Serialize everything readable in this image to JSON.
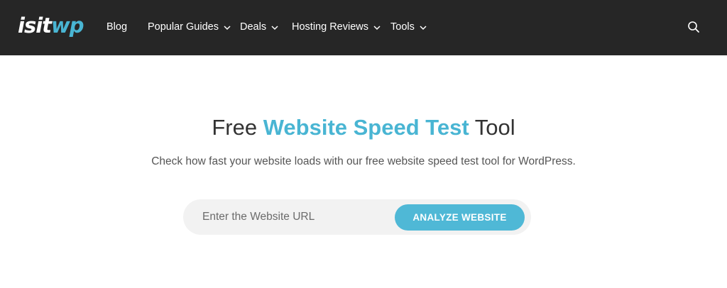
{
  "header": {
    "logo": {
      "part1": "isit",
      "part2": "wp"
    },
    "nav": [
      {
        "label": "Blog",
        "has_dropdown": false
      },
      {
        "label": "Popular Guides",
        "has_dropdown": true
      },
      {
        "label": "Deals",
        "has_dropdown": true
      },
      {
        "label": "Hosting Reviews",
        "has_dropdown": true
      },
      {
        "label": "Tools",
        "has_dropdown": true
      }
    ],
    "search_icon": "search-icon"
  },
  "hero": {
    "title_before": "Free ",
    "title_highlight": "Website Speed Test",
    "title_after": " Tool",
    "subtitle": "Check how fast your website loads with our free website speed test tool for WordPress."
  },
  "form": {
    "url_value": "",
    "url_placeholder": "Enter the Website URL",
    "submit_label": "ANALYZE WEBSITE"
  },
  "colors": {
    "header_bg": "#262626",
    "accent": "#49b5d3",
    "button": "#4fb8d6",
    "input_bg": "#f2f2f2"
  }
}
